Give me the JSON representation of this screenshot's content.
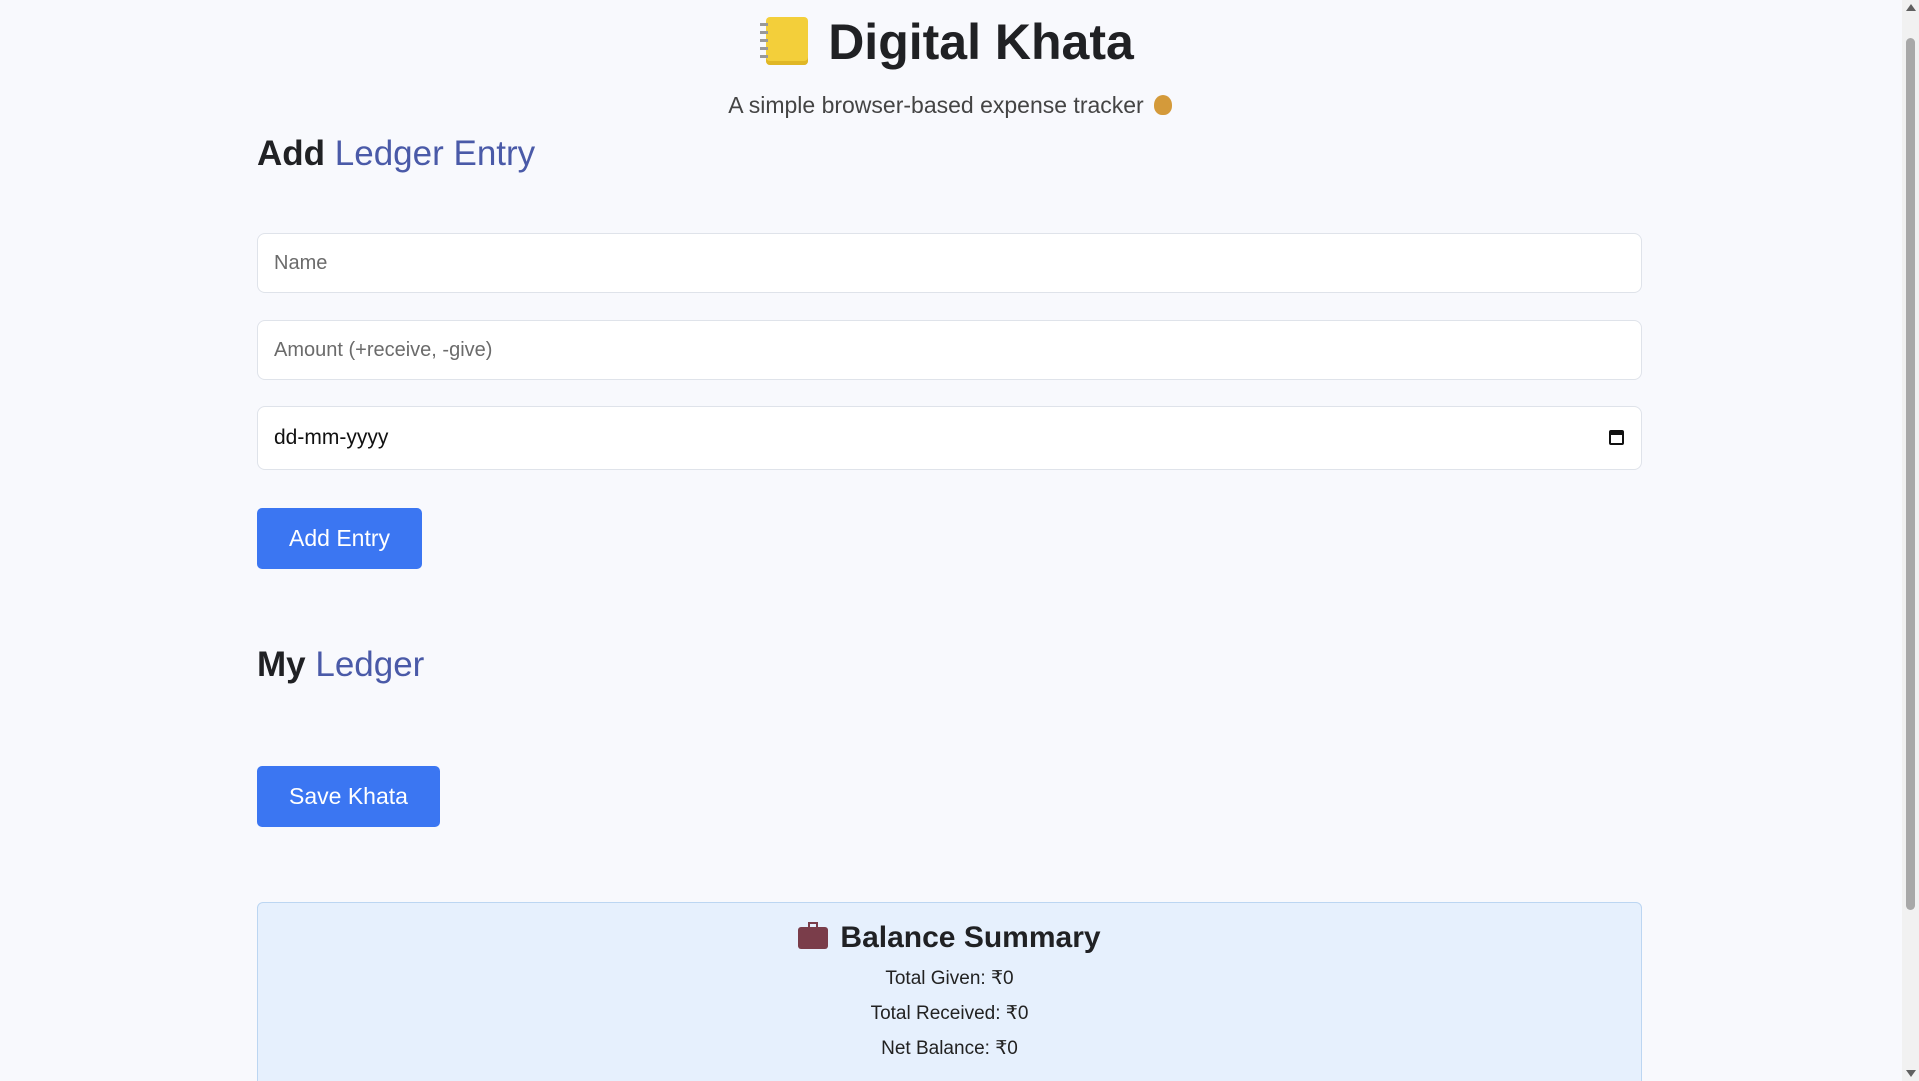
{
  "header": {
    "title": "Digital Khata",
    "subtitle": "A simple browser-based expense tracker"
  },
  "add_entry": {
    "heading_strong": "Add",
    "heading_accent": "Ledger Entry",
    "name_placeholder": "Name",
    "amount_placeholder": "Amount (+receive, -give)",
    "date_placeholder": "dd-mm-yyyy",
    "add_button": "Add Entry"
  },
  "ledger": {
    "heading_strong": "My",
    "heading_accent": "Ledger",
    "save_button": "Save Khata"
  },
  "summary": {
    "title": "Balance Summary",
    "total_given": "Total Given: ₹0",
    "total_received": "Total Received: ₹0",
    "net_balance": "Net Balance: ₹0"
  },
  "icons": {
    "title_icon": "notebook-icon",
    "subtitle_icon": "money-bag-icon",
    "summary_icon": "briefcase-icon",
    "date_icon": "calendar-icon"
  },
  "colors": {
    "accent_text": "#4a5aa8",
    "button": "#3b76f2",
    "summary_bg": "#e6f0fd"
  }
}
